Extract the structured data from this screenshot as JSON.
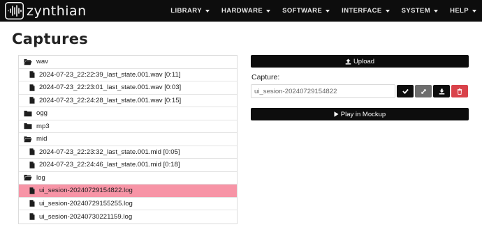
{
  "brand": {
    "name": "zynthian",
    "logo_icon": "waveform-logo-icon"
  },
  "nav": {
    "items": [
      {
        "label": "LIBRARY"
      },
      {
        "label": "HARDWARE"
      },
      {
        "label": "SOFTWARE"
      },
      {
        "label": "INTERFACE"
      },
      {
        "label": "SYSTEM"
      },
      {
        "label": "HELP"
      }
    ],
    "caret_icon": "caret-down-icon"
  },
  "page": {
    "title": "Captures"
  },
  "tree": {
    "rows": [
      {
        "type": "folder",
        "label": "wav",
        "icon": "folder-open-icon"
      },
      {
        "type": "file",
        "label": "2024-07-23_22:22:39_last_state.001.wav [0:11]",
        "icon": "file-icon"
      },
      {
        "type": "file",
        "label": "2024-07-23_22:23:01_last_state.001.wav [0:03]",
        "icon": "file-icon"
      },
      {
        "type": "file",
        "label": "2024-07-23_22:24:28_last_state.001.wav [0:15]",
        "icon": "file-icon"
      },
      {
        "type": "folder",
        "label": "ogg",
        "icon": "folder-icon"
      },
      {
        "type": "folder",
        "label": "mp3",
        "icon": "folder-icon"
      },
      {
        "type": "folder",
        "label": "mid",
        "icon": "folder-open-icon"
      },
      {
        "type": "file",
        "label": "2024-07-23_22:23:32_last_state.001.mid [0:05]",
        "icon": "file-icon"
      },
      {
        "type": "file",
        "label": "2024-07-23_22:24:46_last_state.001.mid [0:18]",
        "icon": "file-icon"
      },
      {
        "type": "folder",
        "label": "log",
        "icon": "folder-open-icon"
      },
      {
        "type": "file",
        "label": "ui_sesion-20240729154822.log",
        "icon": "file-icon",
        "selected": true
      },
      {
        "type": "file",
        "label": "ui_sesion-20240729155255.log",
        "icon": "file-icon"
      },
      {
        "type": "file",
        "label": "ui_sesion-20240730221159.log",
        "icon": "file-icon"
      }
    ],
    "selected_color": "#f794a6"
  },
  "panel": {
    "upload_label": "Upload",
    "capture_label": "Capture:",
    "capture_value": "ui_sesion-20240729154822",
    "buttons": [
      {
        "name": "confirm",
        "icon": "check-icon",
        "color": "#0d0d0d"
      },
      {
        "name": "expand",
        "icon": "expand-icon",
        "color": "#6d6d6d"
      },
      {
        "name": "download",
        "icon": "download-icon",
        "color": "#0d0d0d"
      },
      {
        "name": "delete",
        "icon": "trash-icon",
        "color": "#d9424a"
      }
    ],
    "play_label": "Play in Mockup"
  }
}
